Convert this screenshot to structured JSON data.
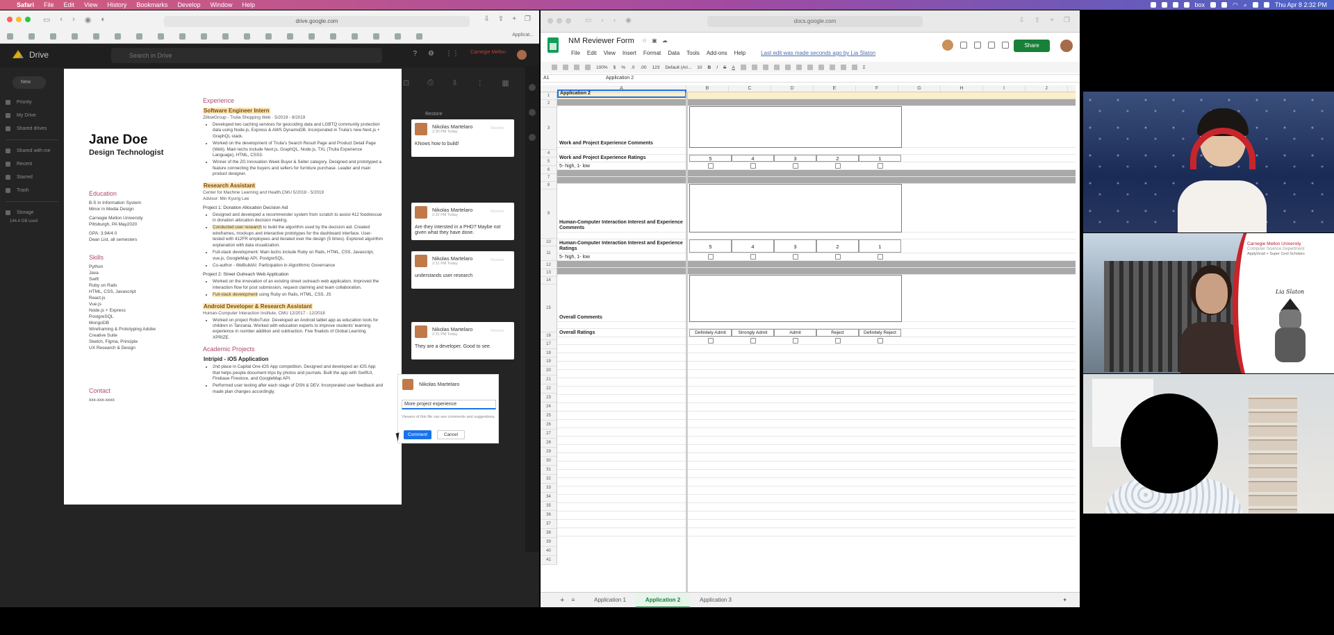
{
  "menubar": {
    "app": "Safari",
    "items": [
      "File",
      "Edit",
      "View",
      "History",
      "Bookmarks",
      "Develop",
      "Window",
      "Help"
    ],
    "clock": "Thu Apr 8  2:32 PM",
    "box": "box"
  },
  "left": {
    "url": "drive.google.com",
    "tab_label": "Applicat...",
    "drive": {
      "logo": "Drive",
      "search_placeholder": "Search in Drive",
      "brand": "Carnegie Mellon",
      "new_label": "New",
      "nav": [
        "Priority",
        "My Drive",
        "Shared drives",
        "Shared with me",
        "Recent",
        "Starred",
        "Trash",
        "Storage"
      ],
      "storage": "144.4 GB used"
    },
    "resume": {
      "name": "Jane Doe",
      "role": "Design Technologist",
      "education_title": "Education",
      "education": [
        "B.S in Information System",
        "Minor in Media Design",
        "",
        "Carnegie Mellon University",
        "Pittsburgh, PA May2020",
        "",
        "GPA: 3.94/4.0",
        "Dean List, all semesters"
      ],
      "skills_title": "Skills",
      "skills": [
        "Python",
        "Java",
        "Swift",
        "Ruby on Rails",
        "HTML, CSS, Javascript",
        "React.js",
        "Vue.js",
        "Node.js + Express",
        "PostgreSQL",
        "MongoDB",
        "Wireframing & Prototyping Adobe",
        "Creative Suite",
        "Sketch, Figma, Principle",
        "UX Research & Design"
      ],
      "contact_title": "Contact",
      "contact": "xxx-xxx-xxxx",
      "experience_title": "Experience",
      "job1_title": "Software Engineer Intern",
      "job1_sub": "ZillowGroup - Trulia Shopping Web  ·  5/2019 - 8/2019",
      "job1_b1": "Developed two caching services for geocoding data and LGBTQ community protection data using Node.js, Express & AWS DynamoDB. Incorporated in Trulia's new Next.js + GraphQL stack.",
      "job1_b2": "Worked on the development of Trulia's Search Result Page and Product Detail Page (Web). Main techs include Next.js, GraphQL, Node.js, TXL (Trulia Experience Language), HTML, CSS3.",
      "job1_b3": "Winner of the ZG Innovation Week Buyer & Seller category. Designed and prototyped a feature connecting the buyers and sellers for furniture purchase. Leader and main product designer.",
      "job2_title": "Research Assistant",
      "job2_sub": "Center for Machine Learning and Health,CMU   5/2018 - 5/2019",
      "job2_adv": "Advisor: Min Kyung Lee",
      "job2_p1": "Project 1: Donation Allocation Decision Aid",
      "job2_b1": "Designed and developed a recommender system from scratch to assist 412 foodrescue in donation allocation decision making.",
      "job2_b2_hl": "Conducted user research",
      "job2_b2": " to build the algorithm used by the decision aid. Created wireframes, mockups and interactive prototypes for the dashboard interface. User-tested with 412FR employees and iterated over the design (5 times). Explored algorithm explanation with data visualization.",
      "job2_b3": "Full-stack development: Main techs include Ruby on Rails, HTML, CSS, Javascript, vue.js, GoogleMap API, PostgreSQL.",
      "job2_b4": "Co-author - WeBuildAI: Participation in Algorithmic Governance",
      "job2_p2": "Project 2: Street Outreach Web Application",
      "job2_b5": "Worked on the innovation of an existing street outreach web application. Improved the interaction flow for post submission, request claiming and team collaboration.",
      "job2_b6_hl": "Full-stack development",
      "job2_b6": " using Ruby on Rails, HTML, CSS, JS",
      "job3_title": "Android Developer & Research Assistant",
      "job3_sub": "Human-Computer Interaction Institute, CMU    12/2017 - 12/2018",
      "job3_b1": "Worked on project RoboTutor. Developed an Android tablet app as education tools for children in Tanzania. Worked with education experts to improve students' learning experience in number addition and subtraction. Five finalists of Global Learning XPRIZE.",
      "academic_title": "Academic Projects",
      "proj_title": "Intripid - iOS Application",
      "proj_b1": "2nd place in Capital One iOS App competition. Designed and developed an iOS App that helps people document trips by photos and journals. Built the app with SwiftUI, Firebase Firestore, and GoogleMap API.",
      "proj_b2": "Performed user testing after each stage of DSN & DEV. Incorporated user feedback and made plan changes accordingly."
    },
    "comments": [
      {
        "name": "Nikolas Martelaro",
        "time": "2:30 PM Today",
        "text": "KNows how to build!",
        "resolve": "Resolve"
      },
      {
        "name": "Nikolas Martelaro",
        "time": "2:32 PM Today",
        "text": "Are they intersted in a PHD? Maybe not given what they have done.",
        "resolve": "Resolve"
      },
      {
        "name": "Nikolas Martelaro",
        "time": "2:31 PM Today",
        "text": "understands user research",
        "resolve": "Resolve"
      },
      {
        "name": "Nikolas Martelaro",
        "time": "2:31 PM Today",
        "text": "They are a developer. Good to see.",
        "resolve": "Resolve"
      }
    ],
    "restore_label": "Restore",
    "new_comment": {
      "name": "Nikolas Martelaro",
      "value": "More project experience",
      "note": "Viewers of this file can see comments and suggestions.",
      "comment_btn": "Comment",
      "cancel_btn": "Cancel"
    }
  },
  "right": {
    "url": "docs.google.com",
    "title": "NM Reviewer Form",
    "menus": [
      "File",
      "Edit",
      "View",
      "Insert",
      "Format",
      "Data",
      "Tools",
      "Add-ons",
      "Help"
    ],
    "last_edit": "Last edit was made seconds ago by Lia Slaton",
    "share": "Share",
    "toolbar": {
      "zoom": "100%",
      "currency": "$",
      "percent": "%",
      "dec1": ".0",
      "dec2": ".00",
      "fmt": "123",
      "font": "Default (Ari...",
      "size": "10",
      "bold": "B",
      "italic": "I",
      "strike": "S",
      "color": "A"
    },
    "cell_ref": "A1",
    "formula": "Application 2",
    "columns": [
      "A",
      "B",
      "C",
      "D",
      "E",
      "F",
      "G",
      "H",
      "I",
      "J"
    ],
    "rows": [
      "1",
      "2",
      "3",
      "4",
      "5",
      "6",
      "7",
      "8",
      "9",
      "10",
      "11",
      "12",
      "13",
      "14",
      "15",
      "16",
      "17",
      "18",
      "19",
      "20",
      "21",
      "22",
      "23",
      "24",
      "25",
      "26",
      "27",
      "28",
      "29",
      "30",
      "31",
      "32",
      "33",
      "34",
      "35",
      "36",
      "37",
      "38",
      "39",
      "40",
      "41"
    ],
    "labels": {
      "r1": "Application 2",
      "r3": "Work and Project Experience Comments",
      "r5": "Work and Project Experience Ratings",
      "r6": "5- high, 1- low",
      "r9": "Human-Computer Interaction Interest and Experience Comments",
      "r11": "Human-Computer Interaction Interest and Experience Ratings",
      "r12": "5- high, 1- low",
      "r15": "Overall Comments",
      "r17": "Overall Ratings"
    },
    "ratings": [
      "5",
      "4",
      "3",
      "2",
      "1"
    ],
    "overall": [
      "Definitely Admit",
      "Strongly Admit",
      "Admit",
      "Reject",
      "Definitely Reject"
    ],
    "tabs": [
      "Application 1",
      "Application 2",
      "Application 3"
    ],
    "active_tab": "Application 2"
  },
  "video": {
    "brand_line1": "Carnegie Mellon University",
    "brand_line2": "Computer Science Department",
    "brand_line3": "ApplyGrad + Super Cool Scholars",
    "presenter": "Lia Slaton"
  }
}
